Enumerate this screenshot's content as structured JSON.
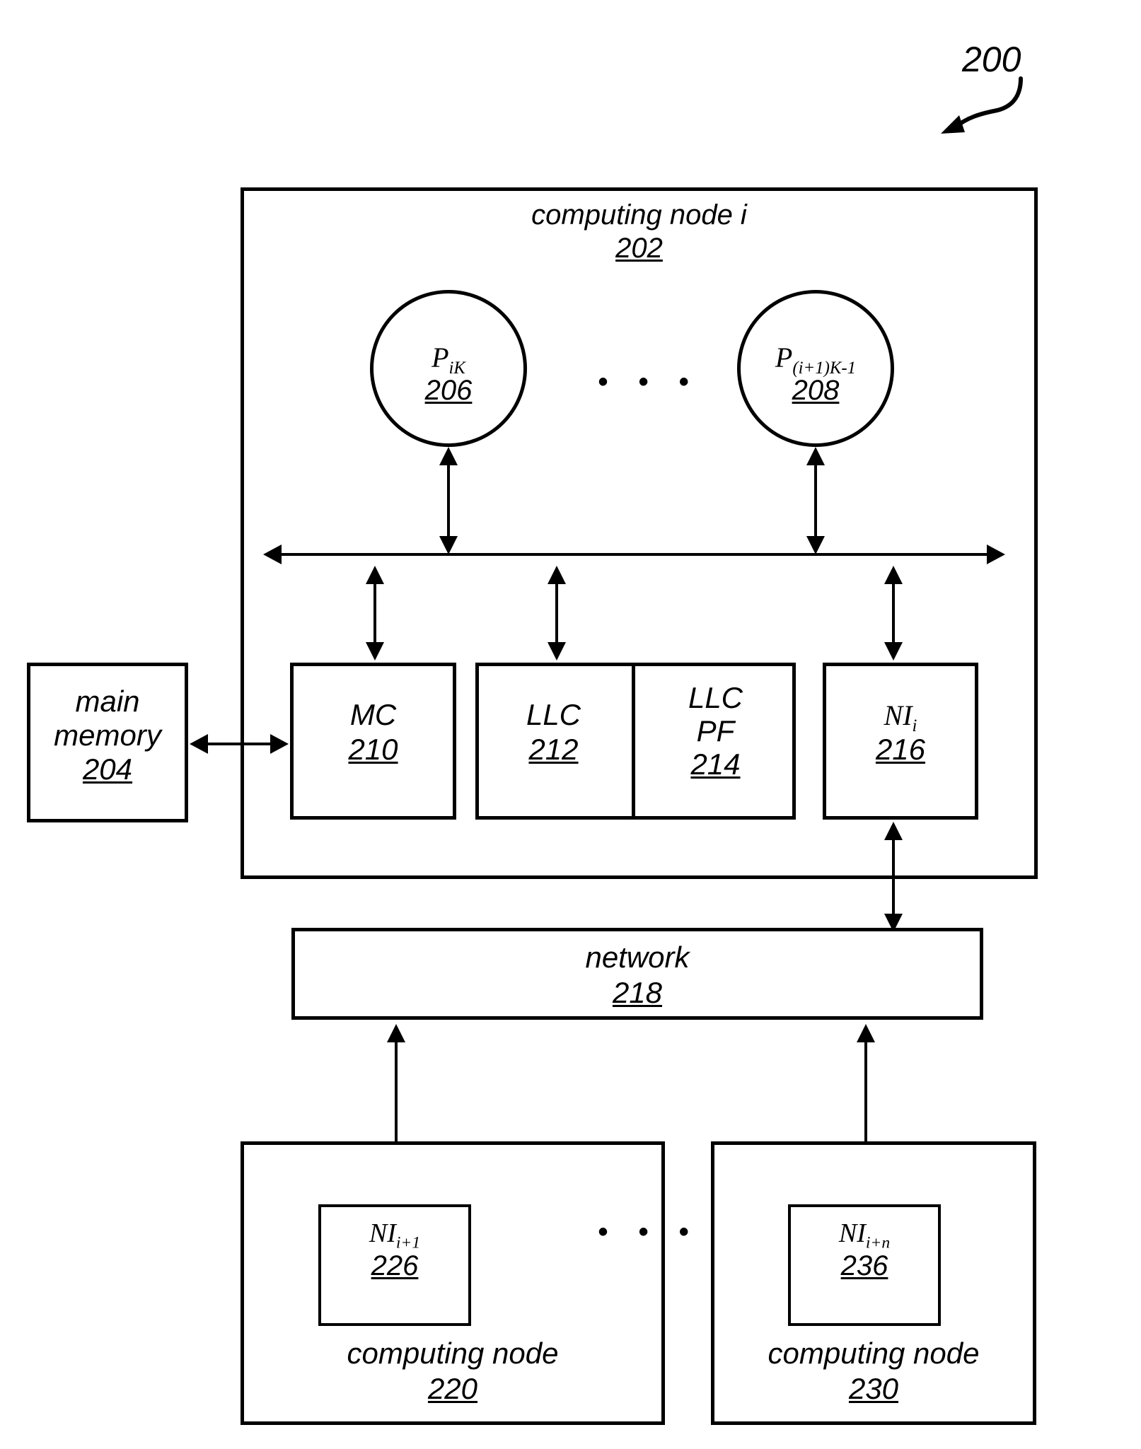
{
  "figure": {
    "reference_numeral": "200",
    "ellipsis": "• • •"
  },
  "main_node": {
    "title": "computing node i",
    "ref": "202",
    "processors": [
      {
        "name_base": "P",
        "name_sub": "iK",
        "ref": "206"
      },
      {
        "name_base": "P",
        "name_sub": "(i+1)K-1",
        "ref": "208"
      }
    ],
    "processor_ellipsis": "• • •",
    "components": [
      {
        "label": "MC",
        "ref": "210"
      },
      {
        "label": "LLC",
        "ref": "212"
      },
      {
        "label_line1": "LLC",
        "label_line2": "PF",
        "ref": "214"
      },
      {
        "name_base": "NI",
        "name_sub": "i",
        "ref": "216"
      }
    ]
  },
  "main_memory": {
    "line1": "main",
    "line2": "memory",
    "ref": "204"
  },
  "network": {
    "label": "network",
    "ref": "218"
  },
  "peer_nodes": [
    {
      "title": "computing node",
      "ref": "220",
      "interface": {
        "name_base": "NI",
        "name_sub": "i+1",
        "ref": "226"
      }
    },
    {
      "title": "computing node",
      "ref": "230",
      "interface": {
        "name_base": "NI",
        "name_sub": "i+n",
        "ref": "236"
      }
    }
  ],
  "peer_ellipsis": "• • •",
  "colors": {
    "stroke": "#000000",
    "background": "#ffffff"
  }
}
